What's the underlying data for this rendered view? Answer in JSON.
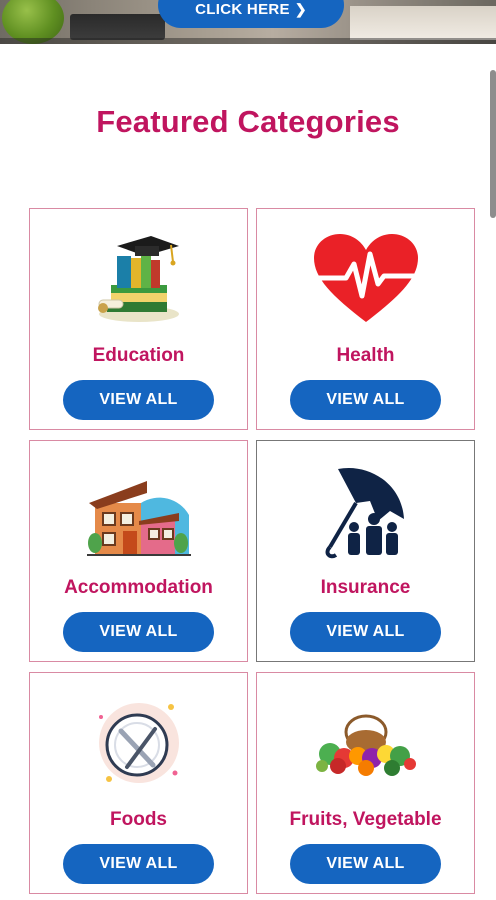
{
  "banner": {
    "cta_label": "CLICK HERE",
    "cta_icon": "chevron-right-icon"
  },
  "section": {
    "title": "Featured Categories"
  },
  "colors": {
    "title": "#c0155f",
    "button": "#1565c0",
    "card_border": "#d98aa3"
  },
  "categories": [
    {
      "label": "Education",
      "icon": "education-books-graduation-cap-icon",
      "button_label": "VIEW ALL"
    },
    {
      "label": "Health",
      "icon": "heart-heartbeat-icon",
      "button_label": "VIEW ALL"
    },
    {
      "label": "Accommodation",
      "icon": "house-icon",
      "button_label": "VIEW ALL"
    },
    {
      "label": "Insurance",
      "icon": "umbrella-family-icon",
      "button_label": "VIEW ALL"
    },
    {
      "label": "Foods",
      "icon": "plate-fork-knife-icon",
      "button_label": "VIEW ALL"
    },
    {
      "label": "Fruits, Vegetable",
      "icon": "fruit-vegetable-basket-icon",
      "button_label": "VIEW ALL"
    }
  ]
}
